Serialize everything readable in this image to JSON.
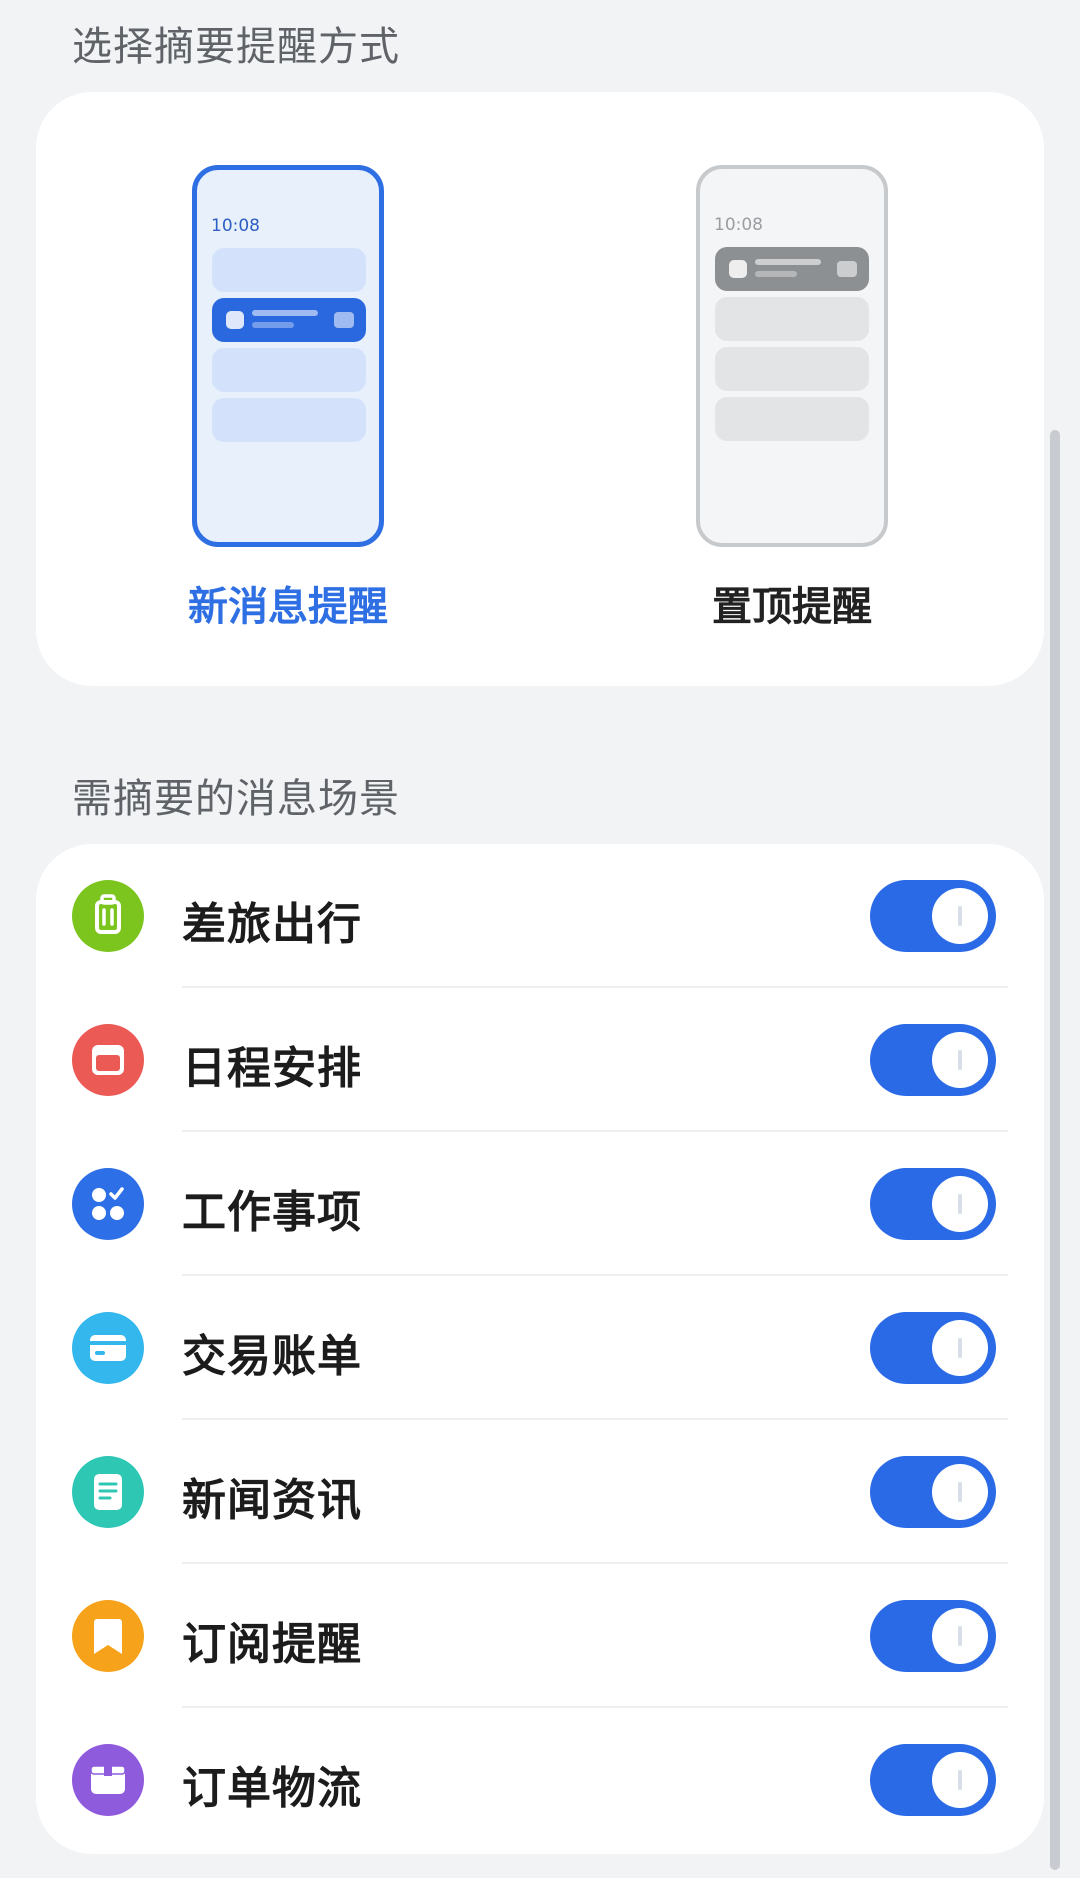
{
  "style_section": {
    "title": "选择摘要提醒方式",
    "options": [
      {
        "label": "新消息提醒",
        "time": "10:08",
        "selected": true
      },
      {
        "label": "置顶提醒",
        "time": "10:08",
        "selected": false
      }
    ]
  },
  "scenes_section": {
    "title": "需摘要的消息场景",
    "items": [
      {
        "label": "差旅出行",
        "icon": "luggage-icon",
        "icon_color": "#7cc51f",
        "enabled": true
      },
      {
        "label": "日程安排",
        "icon": "calendar-icon",
        "icon_color": "#ec5a55",
        "enabled": true
      },
      {
        "label": "工作事项",
        "icon": "tasks-icon",
        "icon_color": "#2d6fe6",
        "enabled": true
      },
      {
        "label": "交易账单",
        "icon": "card-icon",
        "icon_color": "#33b7ec",
        "enabled": true
      },
      {
        "label": "新闻资讯",
        "icon": "news-icon",
        "icon_color": "#2ec7b4",
        "enabled": true
      },
      {
        "label": "订阅提醒",
        "icon": "bookmark-icon",
        "icon_color": "#f7a21b",
        "enabled": true
      },
      {
        "label": "订单物流",
        "icon": "package-icon",
        "icon_color": "#8d5bdc",
        "enabled": true
      }
    ]
  },
  "colors": {
    "accent": "#2f6fe4",
    "toggle_on": "#2a6ae6",
    "background": "#f1f3f5"
  }
}
